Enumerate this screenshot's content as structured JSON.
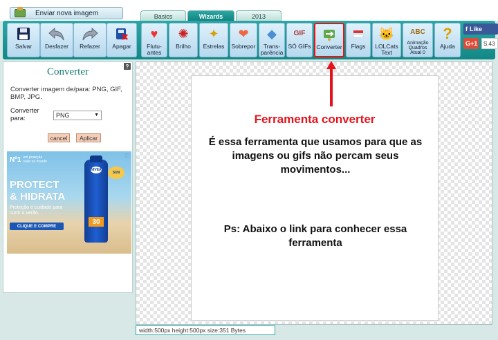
{
  "topbar": {
    "upload_label": "Enviar nova imagem"
  },
  "tabs": [
    {
      "label": "Basics"
    },
    {
      "label": "Wizards"
    },
    {
      "label": "2013"
    }
  ],
  "toolbar": {
    "save": "Salvar",
    "undo": "Desfazer",
    "redo": "Refazer",
    "delete": "Apagar",
    "floaters": "Flutu-\nantes",
    "glitter": "Brilho",
    "stars": "Estrelas",
    "overlay": "Sobrepor",
    "transparency": "Trans-\nparência",
    "gifs_only": "SÓ GIFs",
    "converter": "Converter",
    "flags": "Flags",
    "lolcats": "LOLCats\nText",
    "animation": "Animação\nQuadros\nAtual 0",
    "help": "Ajuda"
  },
  "social": {
    "facebook": "Like",
    "gplus": "G+1",
    "gplus_count": "S.43"
  },
  "panel": {
    "help_glyph": "?",
    "title": "Converter",
    "description": "Converter imagem de/para: PNG, GIF, BMP, JPG.",
    "convert_label": "Converter para:",
    "format_value": "PNG",
    "cancel": "cancel",
    "apply": "Aplicar"
  },
  "ad": {
    "badge": "Nº1",
    "badge_sub": "em proteção solar no mundo",
    "headline": "PROTECT\n& HIDRATA",
    "subtext": "Proteção e cuidado para curtir o verão.",
    "cta": "CLIQUE E COMPRE",
    "brand": "NIVEA",
    "spf": "30",
    "sun": "SUN"
  },
  "canvas": {
    "title": "Ferramenta converter",
    "description": "É essa ferramenta que usamos para que as imagens ou gifs não percam seus movimentos...",
    "note": "Ps: Abaixo o link para conhecer essa ferramenta"
  },
  "status": {
    "info": "width:500px  height:500px  size:351 Bytes"
  },
  "colors": {
    "accent": "#13918e",
    "arrow": "#e6121b"
  }
}
